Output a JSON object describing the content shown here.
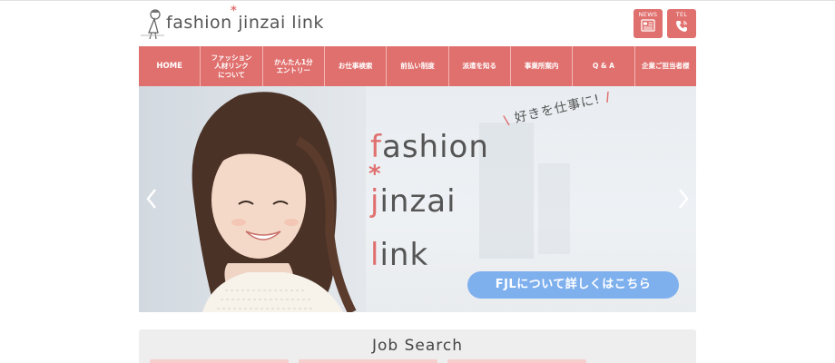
{
  "header": {
    "logo_text": "fashion jinzai link",
    "logo_star": "*",
    "news_label": "NEWS",
    "tel_label": "TEL"
  },
  "nav": {
    "items": [
      {
        "label": "HOME"
      },
      {
        "label": "ファッション\n人材リンク\nについて"
      },
      {
        "label": "かんたん1分\nエントリー"
      },
      {
        "label": "お仕事検索"
      },
      {
        "label": "前払い制度"
      },
      {
        "label": "派遣を知る"
      },
      {
        "label": "事業所案内"
      },
      {
        "label": "Q & A"
      },
      {
        "label": "企業ご担当者様"
      }
    ]
  },
  "hero": {
    "brand_line_1_first": "f",
    "brand_line_1_rest": "ashion",
    "brand_star": "*",
    "brand_line_2_first": "j",
    "brand_line_2_rest": "inzai",
    "brand_line_3_first": "l",
    "brand_line_3_rest": "ink",
    "tagline": "好きを仕事に!",
    "cta_label": "FJLについて詳しくはこちら"
  },
  "job_search": {
    "title": "Job Search"
  },
  "colors": {
    "accent": "#e0706e",
    "cta": "#7fb0ee"
  }
}
